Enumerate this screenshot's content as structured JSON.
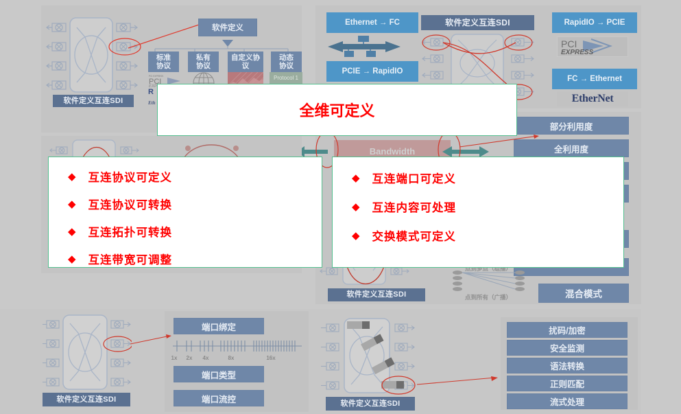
{
  "slide": {
    "background_color": "#c9c9c9",
    "accent_red": "#ff0000",
    "accent_blue": "#6f87a8",
    "accent_bright_blue": "#4e96c8",
    "card_border": "#53c08f"
  },
  "overlay": {
    "title_card": {
      "title": "全维可定义"
    },
    "left_card": {
      "bullet_glyph": "◆",
      "items": [
        "互连协议可定义",
        "互连协议可转换",
        "互连拓扑可转换",
        "互连带宽可调整"
      ]
    },
    "right_card": {
      "bullet_glyph": "◆",
      "items": [
        "互连端口可定义",
        "互连内容可处理",
        "交换模式可定义"
      ]
    }
  },
  "quadrants": {
    "top_left": {
      "sdi_label": "软件定义互连SDI",
      "software_defined_box": "软件定义",
      "protocol_boxes": [
        "标准\n协议",
        "私有\n协议",
        "自定义协\n议",
        "动态\n协议"
      ],
      "protocol_logos": [
        "PCI EXPRESS",
        "globe-logo",
        "waveform-logo",
        "Protocol 1"
      ],
      "secondary_logos": [
        "RapidIO",
        "Ethernet"
      ]
    },
    "top_right": {
      "sdi_label": "软件定义互连SDI",
      "conversions": [
        "Ethernet → FC",
        "PCIE → RapidIO",
        "RapidIO → PCIE",
        "FC → Ethernet"
      ],
      "logos": [
        "PCI EXPRESS",
        "EtherNet"
      ]
    },
    "middle_left": {
      "bandwidth_label": "Bandwidth"
    },
    "middle_right": {
      "sdi_label": "软件定义互连SDI",
      "utilization_buttons": [
        "部分利用度",
        "全利用度",
        "混合模式"
      ],
      "switch_mode_captions": [
        "点到多点（组播）",
        "点到所有（广播）"
      ]
    },
    "bottom_left": {
      "sdi_label": "软件定义互连SDI",
      "port_buttons": [
        "端口绑定",
        "端口类型",
        "端口流控"
      ],
      "lane_scale": [
        "1x",
        "2x",
        "4x",
        "8x",
        "16x"
      ]
    },
    "bottom_right": {
      "sdi_label": "软件定义互连SDI",
      "content_buttons": [
        "扰码/加密",
        "安全监测",
        "语法转换",
        "正则匹配",
        "流式处理"
      ]
    }
  }
}
